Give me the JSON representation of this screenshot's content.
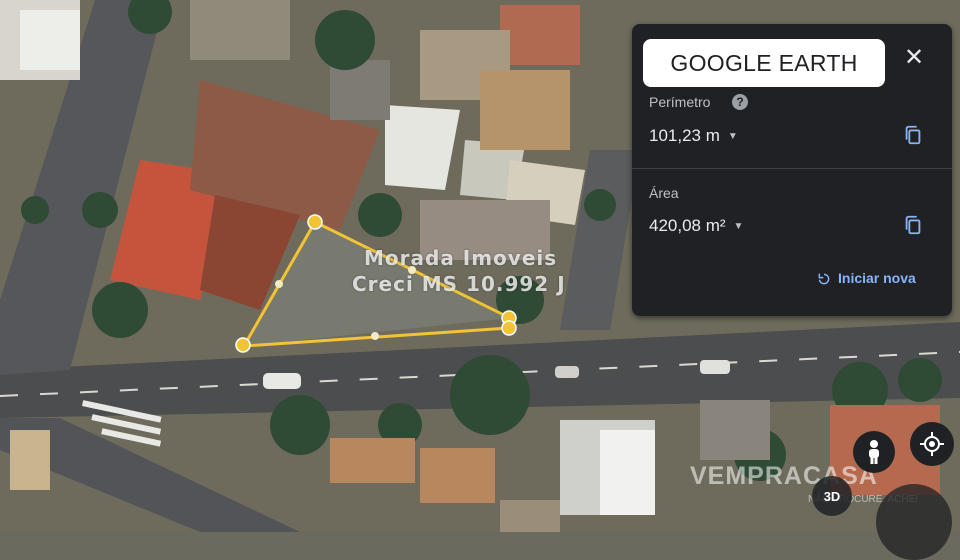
{
  "panel": {
    "title": "GOOGLE EARTH",
    "close_icon": "close-icon",
    "perimeter_label": "Perímetro",
    "perimeter_value": "101,23 m",
    "area_label": "Área",
    "area_value": "420,08 m²",
    "restart_label": "Iniciar nova",
    "accent_color": "#8ab4f8"
  },
  "watermark": {
    "line1": "Morada Imoveis",
    "line2": "Creci MS 10.992 J"
  },
  "brand": {
    "name": "VEMPRACASA",
    "tagline": "NÃO PROCURE. ACHE!"
  },
  "controls": {
    "btn_3d": "3D"
  },
  "polygon": {
    "color": "#f2c335"
  }
}
